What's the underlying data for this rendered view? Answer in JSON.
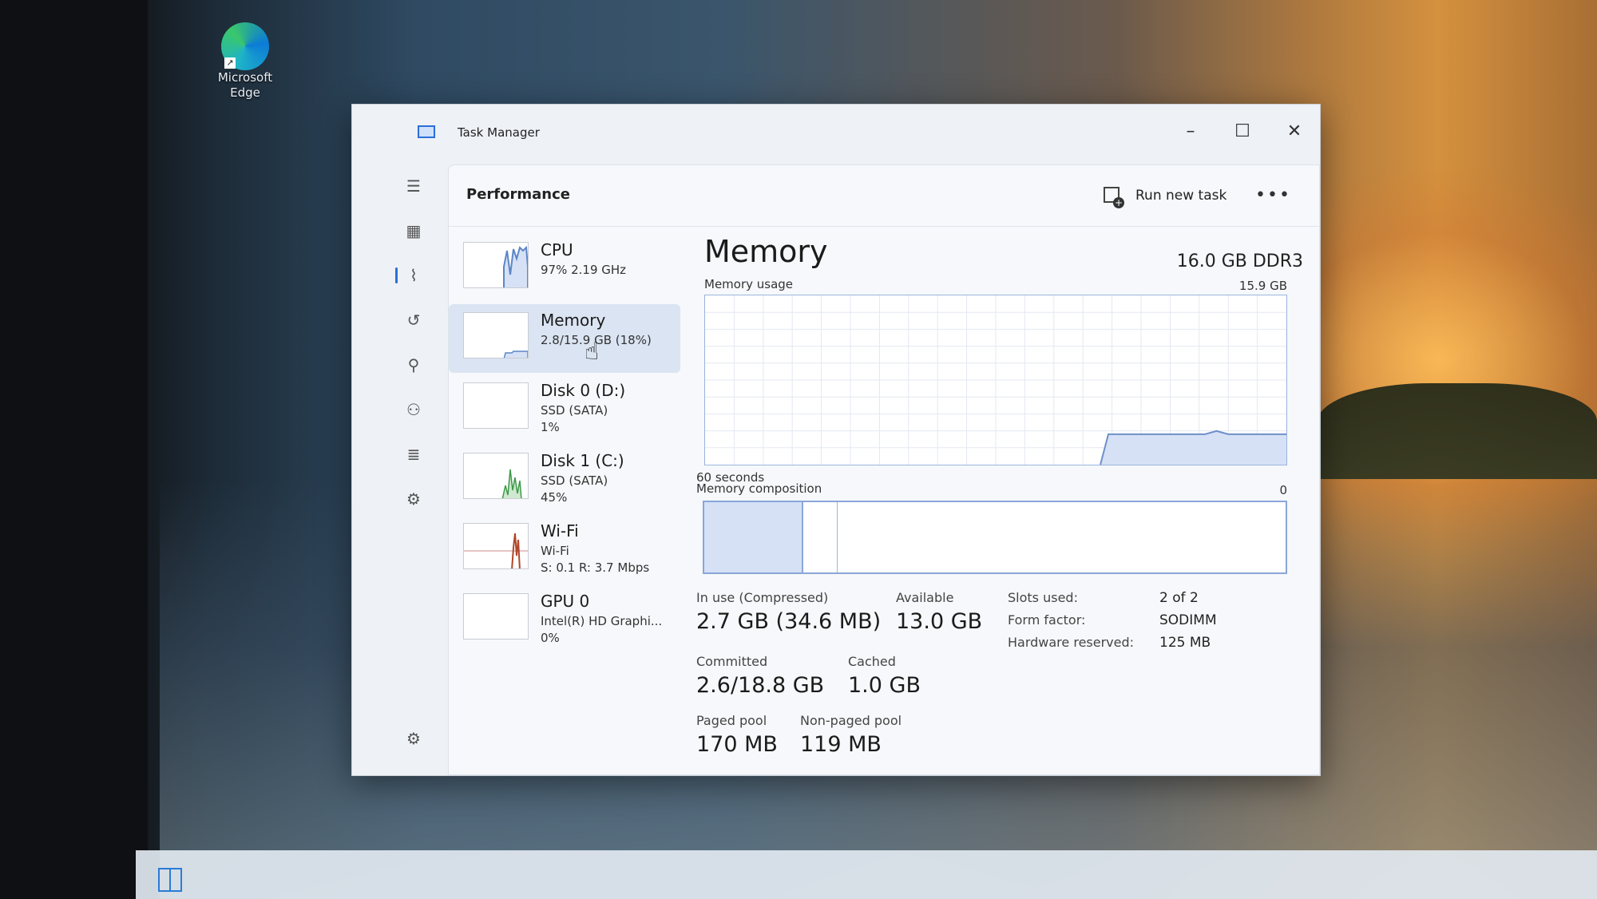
{
  "desktop": {
    "edge_icon_label": "Microsoft Edge"
  },
  "window": {
    "title": "Task Manager",
    "minimize": "–",
    "maximize": "☐",
    "close": "✕"
  },
  "header": {
    "page_title": "Performance",
    "run_new_task": "Run new task",
    "more": "•••"
  },
  "nav_icons": [
    "menu-icon",
    "processes-icon",
    "performance-icon",
    "app-history-icon",
    "startup-icon",
    "users-icon",
    "details-icon",
    "services-icon",
    "settings-icon"
  ],
  "devices": [
    {
      "name": "CPU",
      "sub1": "97% 2.19 GHz",
      "sub2": "",
      "sub3": ""
    },
    {
      "name": "Memory",
      "sub1": "2.8/15.9 GB (18%)",
      "sub2": "",
      "sub3": ""
    },
    {
      "name": "Disk 0 (D:)",
      "sub1": "SSD (SATA)",
      "sub2": "1%",
      "sub3": ""
    },
    {
      "name": "Disk 1 (C:)",
      "sub1": "SSD (SATA)",
      "sub2": "45%",
      "sub3": ""
    },
    {
      "name": "Wi-Fi",
      "sub1": "Wi-Fi",
      "sub2": "S: 0.1 R: 3.7 Mbps",
      "sub3": ""
    },
    {
      "name": "GPU 0",
      "sub1": "Intel(R) HD Graphi...",
      "sub2": "0%",
      "sub3": ""
    }
  ],
  "memory": {
    "title": "Memory",
    "spec": "16.0 GB DDR3",
    "usage_label": "Memory usage",
    "usage_max": "15.9 GB",
    "time_label": "60 seconds",
    "composition_label": "Memory composition",
    "composition_zero": "0",
    "stats": {
      "in_use_label": "In use (Compressed)",
      "in_use_value": "2.7 GB (34.6 MB)",
      "available_label": "Available",
      "available_value": "13.0 GB",
      "committed_label": "Committed",
      "committed_value": "2.6/18.8 GB",
      "cached_label": "Cached",
      "cached_value": "1.0 GB",
      "paged_label": "Paged pool",
      "paged_value": "170 MB",
      "nonpaged_label": "Non-paged pool",
      "nonpaged_value": "119 MB"
    },
    "hardware": {
      "slots_label": "Slots used:",
      "slots_value": "2 of 2",
      "form_label": "Form factor:",
      "form_value": "SODIMM",
      "reserved_label": "Hardware reserved:",
      "reserved_value": "125 MB"
    },
    "usage_fraction": 0.18
  },
  "colors": {
    "accent": "#2a6fd6",
    "graph_line": "#6f8fc8",
    "graph_fill": "#d6e1f6"
  }
}
